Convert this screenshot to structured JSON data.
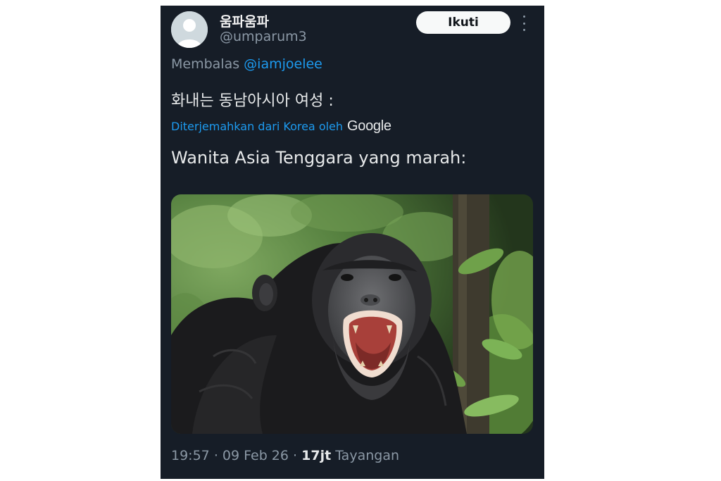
{
  "tweet": {
    "author": {
      "display_name": "움파움파",
      "handle": "@umparum3",
      "avatar_icon": "default-avatar-icon"
    },
    "follow_label": "Ikuti",
    "more_icon": "more-options-icon",
    "reply": {
      "prefix": "Membalas",
      "mention": "@iamjoelee"
    },
    "text_original": "화내는 동남아시아 여성 :",
    "translation": {
      "label": "Diterjemahkan dari Korea oleh",
      "provider": "Google"
    },
    "text_translated": "Wanita Asia Tenggara yang marah:",
    "media": {
      "subject": "chimpanzee-photo"
    },
    "meta": {
      "time": "19:57",
      "separator": "·",
      "date": "09 Feb 26",
      "views_count": "17jt",
      "views_label": "Tayangan"
    }
  },
  "colors": {
    "card_background": "#161d27",
    "link_blue": "#1d9bf0",
    "muted_text": "#8b98a5",
    "primary_text": "#e7e9ea"
  }
}
